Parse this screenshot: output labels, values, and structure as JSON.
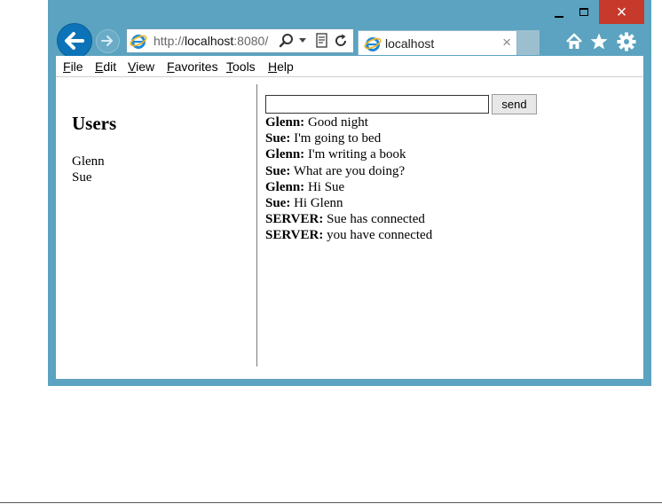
{
  "browser": {
    "address_url_prefix": "http://",
    "address_url_host": "localhost",
    "address_url_suffix": ":8080/",
    "tab_title": "localhost",
    "tab_close": "×",
    "window_close": "×"
  },
  "menubar": {
    "items": [
      "File",
      "Edit",
      "View",
      "Favorites",
      "Tools",
      "Help"
    ]
  },
  "sidebar": {
    "title": "Users",
    "users": [
      "Glenn",
      "Sue"
    ]
  },
  "chat": {
    "input_value": "",
    "send_label": "send",
    "messages": [
      {
        "sender": "Glenn:",
        "text": " Good night"
      },
      {
        "sender": "Sue:",
        "text": " I'm going to bed"
      },
      {
        "sender": "Glenn:",
        "text": " I'm writing a book"
      },
      {
        "sender": "Sue:",
        "text": " What are you doing?"
      },
      {
        "sender": "Glenn:",
        "text": " Hi Sue"
      },
      {
        "sender": "Sue:",
        "text": " Hi Glenn"
      },
      {
        "sender": "SERVER:",
        "text": " Sue has connected"
      },
      {
        "sender": "SERVER:",
        "text": " you have connected"
      }
    ]
  },
  "colors": {
    "frame": "#5ba3c0",
    "close_button": "#c7392b",
    "back_button": "#0c73b8"
  }
}
